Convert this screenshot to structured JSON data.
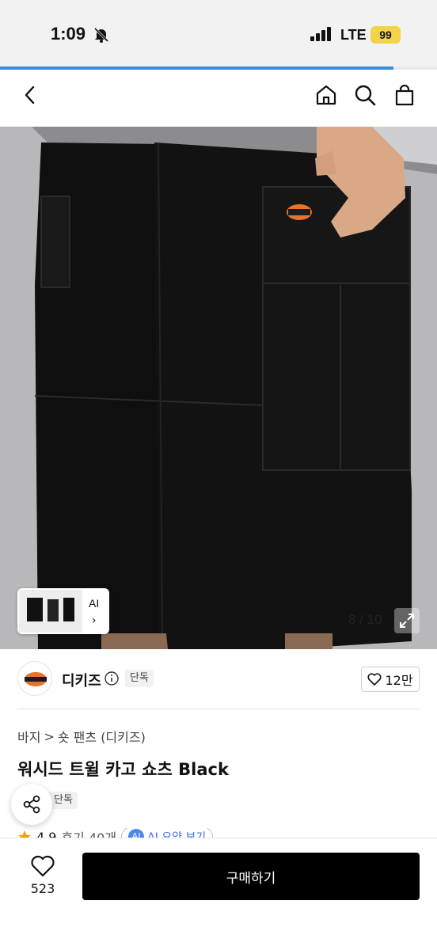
{
  "status_bar": {
    "time": "1:09",
    "carrier": "LTE",
    "battery": "99"
  },
  "page_load_progress": 0.9,
  "nav": {
    "icons": [
      "back-arrow-icon",
      "home-icon",
      "search-icon",
      "shopping-bag-icon"
    ]
  },
  "gallery": {
    "thumb_label": "AI",
    "thumb_chevron": "›",
    "counter": "8 / 10"
  },
  "brand": {
    "name": "디키즈",
    "exclusive_label": "단독",
    "likes": "12만"
  },
  "breadcrumb": [
    "바지",
    "숏 팬츠 (디키즈)"
  ],
  "breadcrumb_separator": ">",
  "product": {
    "title": "워시드 트윌 카고 쇼츠 Black",
    "exclusive_label": "단독",
    "rating": "4.9",
    "reviews": "후기 40개",
    "ai_badge": "AI",
    "ai_summary": "AI 요약 보기"
  },
  "bottom": {
    "like_count": "523",
    "buy_label": "구매하기"
  },
  "colors": {
    "accent_blue": "#3a8fd6",
    "buy_button": "#000000",
    "battery": "#f3d34a",
    "ai_blue": "#4d86f0"
  }
}
